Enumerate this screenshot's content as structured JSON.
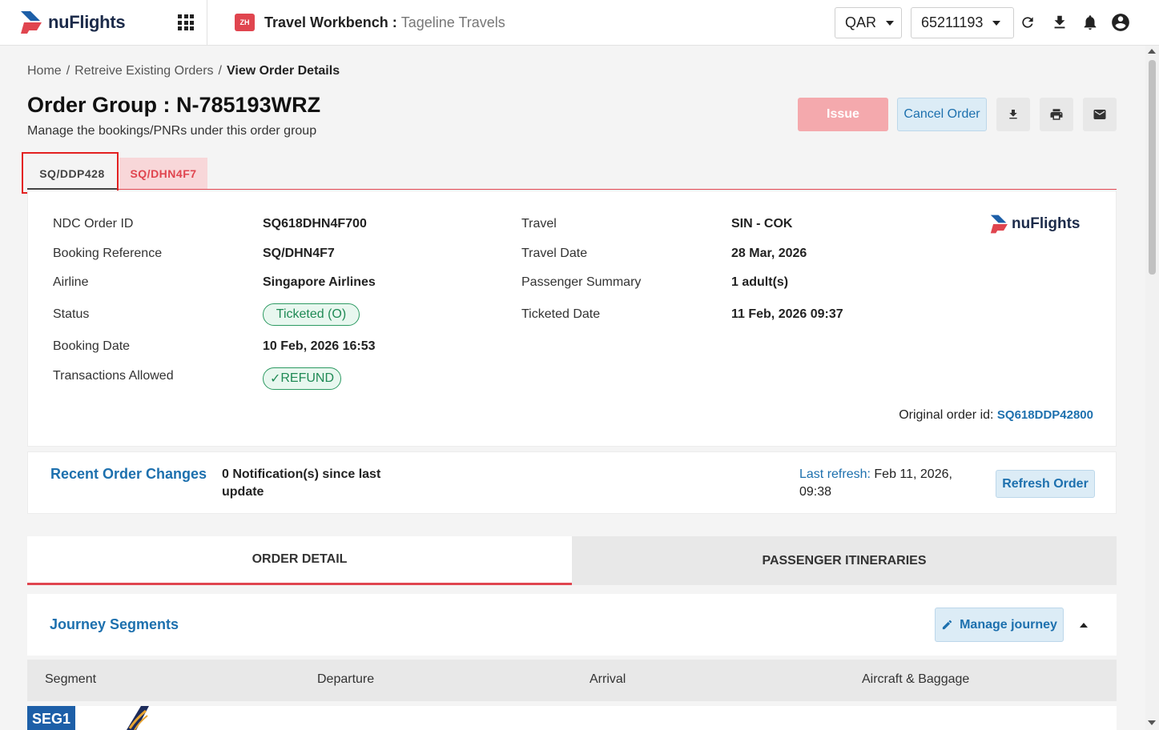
{
  "header": {
    "logo_text": "nuFlights",
    "workbench_icon_text": "ZH",
    "workbench_title": "Travel Workbench",
    "workbench_separator": " : ",
    "workbench_agency": "Tageline Travels",
    "currency": "QAR",
    "account": "65211193"
  },
  "breadcrumb": {
    "items": [
      "Home",
      "Retreive Existing Orders",
      "View Order Details"
    ],
    "separator": "/"
  },
  "page": {
    "title": "Order Group : N-785193WRZ",
    "subtitle": "Manage the bookings/PNRs under this order group"
  },
  "actions": {
    "issue_label": "Issue",
    "cancel_label": "Cancel Order"
  },
  "pnr_tabs": [
    "SQ/DDP428",
    "SQ/DHN4F7"
  ],
  "order": {
    "left": [
      {
        "label": "NDC Order ID",
        "value": "SQ618DHN4F700"
      },
      {
        "label": "Booking Reference",
        "value": "SQ/DHN4F7"
      },
      {
        "label": "Airline",
        "value": "Singapore Airlines"
      },
      {
        "label": "Status",
        "value": "Ticketed (O)"
      },
      {
        "label": "Booking Date",
        "value": "10 Feb, 2026 16:53"
      },
      {
        "label": "Transactions Allowed",
        "value": "REFUND"
      }
    ],
    "right": [
      {
        "label": "Travel",
        "value": "SIN - COK"
      },
      {
        "label": "Travel Date",
        "value": "28 Mar, 2026"
      },
      {
        "label": "Passenger Summary",
        "value": "1 adult(s)"
      },
      {
        "label": "Ticketed Date",
        "value": "11 Feb, 2026 09:37"
      }
    ],
    "refund_check": "✓",
    "original_label": "Original order id: ",
    "original_id": "SQ618DDP42800"
  },
  "changes": {
    "title": "Recent Order Changes",
    "count_text": "0 Notification(s) since last update",
    "refresh_label": "Last refresh:",
    "refresh_value": "Feb 11, 2026, 09:38",
    "refresh_button": "Refresh Order"
  },
  "main_tabs": [
    "ORDER DETAIL",
    "PASSENGER ITINERARIES"
  ],
  "journey": {
    "title": "Journey Segments",
    "manage_label": "Manage journey",
    "columns": [
      "Segment",
      "Departure",
      "Arrival",
      "Aircraft & Baggage"
    ],
    "first_segment": "SEG1"
  },
  "colors": {
    "brand_red": "#e0454f",
    "link_blue": "#1d70ae",
    "status_green": "#1f8a55",
    "segment_blue": "#1d5fa8"
  }
}
